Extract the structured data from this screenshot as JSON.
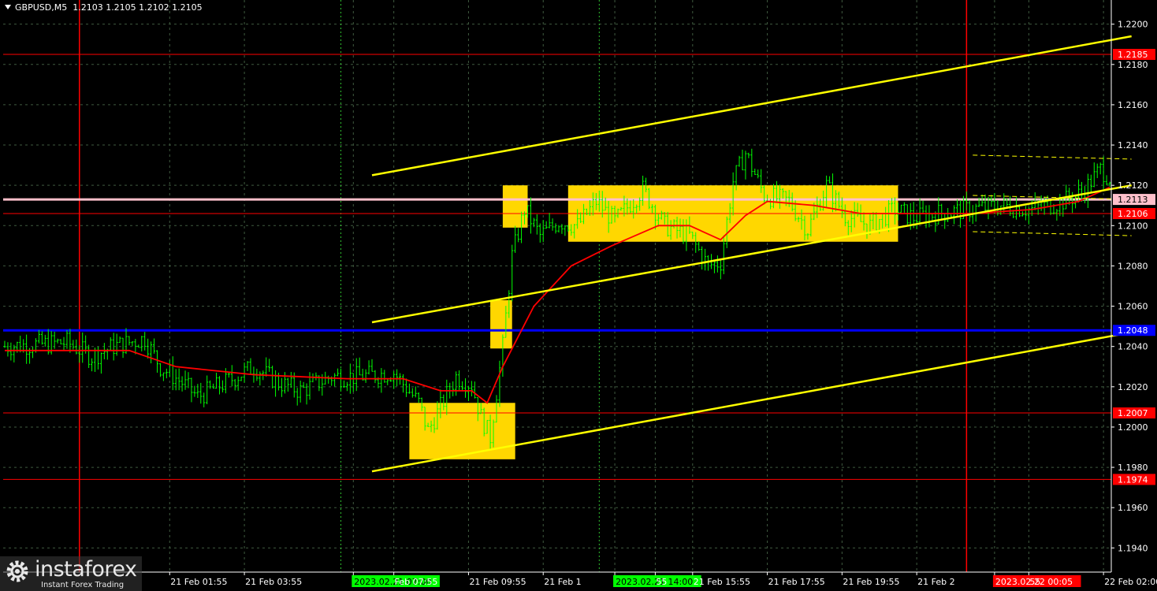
{
  "header": {
    "symbol": "GBPUSD,M5",
    "ohlc": "1.2103 1.2105 1.2102 1.2105"
  },
  "logo": {
    "brand": "instaforex",
    "tagline": "Instant Forex Trading"
  },
  "colors": {
    "background": "#000000",
    "grid": "#3f5a3f",
    "candle": "#00ff00",
    "ma": "#ff0000",
    "support_resistance": "#ff0000",
    "kijun": "#0000ff",
    "senkou": "#ff0000",
    "channel": "#ffff00",
    "zone": "#ffd700",
    "pink_level": "#ffc0cb",
    "time_green": "#00ff00",
    "time_red": "#ff0000",
    "axis_text": "#ffffff"
  },
  "chart_data": {
    "type": "candlestick",
    "title": "",
    "xlabel": "",
    "ylabel": "",
    "ylim": [
      1.1928,
      1.2212
    ],
    "grid": true,
    "y_ticks": [
      "1.1940",
      "1.1960",
      "1.1980",
      "1.2000",
      "1.2020",
      "1.2040",
      "1.2060",
      "1.2080",
      "1.2100",
      "1.2120",
      "1.2140",
      "1.2160",
      "1.2180",
      "1.2200"
    ],
    "x_ticks": [
      {
        "label": "21 Feb 01:55",
        "bar": 53,
        "highlight": ""
      },
      {
        "label": "21 Feb 03:55",
        "bar": 77,
        "highlight": ""
      },
      {
        "label": "2023.02.21 07:00",
        "bar": 112,
        "highlight": "green"
      },
      {
        "label": "Feb 07:55",
        "bar": 125,
        "highlight": ""
      },
      {
        "label": "21 Feb 09:55",
        "bar": 149,
        "highlight": ""
      },
      {
        "label": "21 Feb 1",
        "bar": 173,
        "highlight": ""
      },
      {
        "label": "2023.02.21 14:00",
        "bar": 196,
        "highlight": "green"
      },
      {
        "label": "55",
        "bar": 209,
        "highlight": ""
      },
      {
        "label": "21 Feb 15:55",
        "bar": 221,
        "highlight": ""
      },
      {
        "label": "21 Feb 17:55",
        "bar": 245,
        "highlight": ""
      },
      {
        "label": "21 Feb 19:55",
        "bar": 269,
        "highlight": ""
      },
      {
        "label": "21 Feb 2",
        "bar": 293,
        "highlight": ""
      },
      {
        "label": "2023.02.22 00:05",
        "bar": 318,
        "highlight": "red"
      },
      {
        "label": "55",
        "bar": 329,
        "highlight": ""
      },
      {
        "label": "22 Feb 02:00",
        "bar": 353,
        "highlight": ""
      }
    ],
    "price_levels": [
      {
        "name": "resistance-1.2185",
        "value": 1.2185,
        "label": "1.2185",
        "color": "#ff0000",
        "width": 1
      },
      {
        "name": "pink-level-1.2113",
        "value": 1.2113,
        "label": "1.2113",
        "color": "#ffc0cb",
        "width": 3
      },
      {
        "name": "senkou-1.2106",
        "value": 1.2106,
        "label": "1.2106",
        "color": "#ff0000",
        "width": 1
      },
      {
        "name": "kijun-1.2048",
        "value": 1.2048,
        "label": "1.2048",
        "color": "#0000ff",
        "width": 3
      },
      {
        "name": "support-1.2007",
        "value": 1.2007,
        "label": "1.2007",
        "color": "#ff0000",
        "width": 1
      },
      {
        "name": "support-1.1974",
        "value": 1.1974,
        "label": "1.1974",
        "color": "#ff0000",
        "width": 1
      }
    ],
    "zones": [
      {
        "bar_start": 130,
        "bar_end": 164,
        "low": 1.1984,
        "high": 1.2012
      },
      {
        "bar_start": 156,
        "bar_end": 163,
        "low": 1.2039,
        "high": 1.2063
      },
      {
        "bar_start": 160,
        "bar_end": 168,
        "low": 1.2099,
        "high": 1.212
      },
      {
        "bar_start": 181,
        "bar_end": 287,
        "low": 1.2092,
        "high": 1.212
      }
    ],
    "channel_lines": [
      {
        "bar1": 118,
        "price1": 1.2125,
        "bar2": 362,
        "price2": 1.2194
      },
      {
        "bar1": 118,
        "price1": 1.2052,
        "bar2": 362,
        "price2": 1.212
      },
      {
        "bar1": 118,
        "price1": 1.1978,
        "bar2": 362,
        "price2": 1.2047
      }
    ],
    "dashed_lines": [
      {
        "bar1": 311,
        "price1": 1.2135,
        "bar2": 362,
        "price2": 1.2133
      },
      {
        "bar1": 311,
        "price1": 1.2115,
        "bar2": 362,
        "price2": 1.2113
      },
      {
        "bar1": 311,
        "price1": 1.2097,
        "bar2": 362,
        "price2": 1.2095
      }
    ],
    "vlines_red": [
      24,
      309
    ],
    "vlines_green": [
      108,
      191
    ],
    "anchors": [
      [
        0,
        1.204
      ],
      [
        20,
        1.2042
      ],
      [
        28,
        1.2035
      ],
      [
        35,
        1.204
      ],
      [
        45,
        1.2044
      ],
      [
        50,
        1.203
      ],
      [
        57,
        1.2022
      ],
      [
        62,
        1.2015
      ],
      [
        72,
        1.2023
      ],
      [
        80,
        1.203
      ],
      [
        88,
        1.2022
      ],
      [
        95,
        1.2018
      ],
      [
        105,
        1.2025
      ],
      [
        113,
        1.2025
      ],
      [
        125,
        1.2027
      ],
      [
        133,
        1.2012
      ],
      [
        136,
        1.1998
      ],
      [
        145,
        1.2025
      ],
      [
        150,
        1.2021
      ],
      [
        153,
        1.2005
      ],
      [
        156,
        1.1995
      ],
      [
        160,
        1.204
      ],
      [
        163,
        1.2085
      ],
      [
        167,
        1.2108
      ],
      [
        172,
        1.2095
      ],
      [
        178,
        1.2102
      ],
      [
        184,
        1.21
      ],
      [
        190,
        1.2112
      ],
      [
        196,
        1.2102
      ],
      [
        205,
        1.2118
      ],
      [
        212,
        1.21
      ],
      [
        220,
        1.2095
      ],
      [
        226,
        1.208
      ],
      [
        230,
        1.2082
      ],
      [
        234,
        1.2122
      ],
      [
        238,
        1.2136
      ],
      [
        244,
        1.2115
      ],
      [
        252,
        1.2112
      ],
      [
        258,
        1.2098
      ],
      [
        264,
        1.212
      ],
      [
        270,
        1.2105
      ],
      [
        278,
        1.21
      ],
      [
        286,
        1.2108
      ],
      [
        292,
        1.2104
      ],
      [
        300,
        1.2106
      ],
      [
        310,
        1.2108
      ],
      [
        320,
        1.211
      ],
      [
        330,
        1.2108
      ],
      [
        340,
        1.2112
      ],
      [
        346,
        1.2116
      ],
      [
        352,
        1.2128
      ],
      [
        355,
        1.2124
      ]
    ],
    "ma_points": [
      [
        0,
        1.2038
      ],
      [
        40,
        1.2038
      ],
      [
        55,
        1.203
      ],
      [
        80,
        1.2026
      ],
      [
        110,
        1.2024
      ],
      [
        128,
        1.2024
      ],
      [
        140,
        1.2018
      ],
      [
        150,
        1.2018
      ],
      [
        155,
        1.2012
      ],
      [
        160,
        1.203
      ],
      [
        170,
        1.206
      ],
      [
        182,
        1.208
      ],
      [
        195,
        1.209
      ],
      [
        210,
        1.21
      ],
      [
        220,
        1.21
      ],
      [
        230,
        1.2093
      ],
      [
        238,
        1.2105
      ],
      [
        245,
        1.2112
      ],
      [
        260,
        1.211
      ],
      [
        275,
        1.2106
      ],
      [
        290,
        1.2106
      ],
      [
        310,
        1.2106
      ],
      [
        330,
        1.2108
      ],
      [
        345,
        1.2112
      ],
      [
        355,
        1.2119
      ]
    ],
    "bars_total": 356
  }
}
